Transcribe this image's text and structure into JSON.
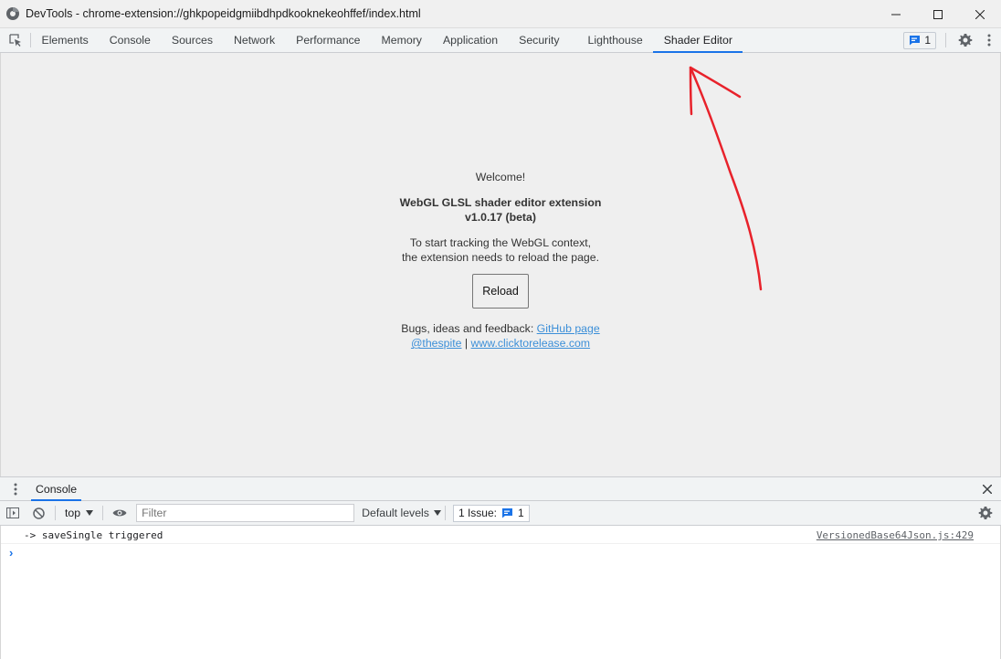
{
  "window": {
    "title": "DevTools - chrome-extension://ghkpopeidgmiibdhpdkooknekeohffef/index.html"
  },
  "tabs": [
    "Elements",
    "Console",
    "Sources",
    "Network",
    "Performance",
    "Memory",
    "Application",
    "Security",
    "Lighthouse",
    "Shader Editor"
  ],
  "active_tab": "Shader Editor",
  "toolbar": {
    "issues_count": "1"
  },
  "welcome": {
    "greeting": "Welcome!",
    "title_line1": "WebGL GLSL shader editor extension",
    "title_line2": "v1.0.17 (beta)",
    "desc_line1": "To start tracking the WebGL context,",
    "desc_line2": "the extension needs to reload the page.",
    "reload_label": "Reload",
    "feedback_prefix": "Bugs, ideas and feedback: ",
    "github_link": "GitHub page",
    "twitter_link": "@thespite",
    "link_separator": " | ",
    "site_link": "www.clicktorelease.com"
  },
  "annotation": {
    "arrow_color": "#e8222b"
  },
  "drawer": {
    "tab_label": "Console"
  },
  "console_toolbar": {
    "context": "top",
    "filter_placeholder": "Filter",
    "levels_label": "Default levels",
    "issue_label": "1 Issue:",
    "issue_count": "1"
  },
  "console_log": [
    {
      "message": "-> saveSingle triggered",
      "source": "VersionedBase64Json.js:429"
    }
  ],
  "colors": {
    "accent": "#1a73e8",
    "link": "#3c8fd8"
  }
}
